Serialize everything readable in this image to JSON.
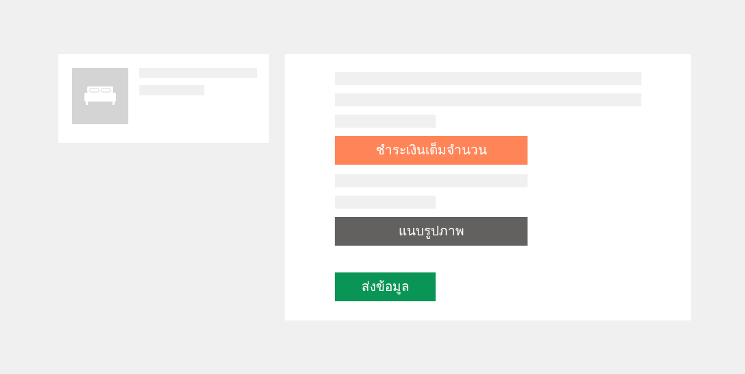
{
  "buttons": [
    {
      "label": "ชำระเงินเต็มจำนวน",
      "kind": "pay"
    },
    {
      "label": "แนบรูปภาพ",
      "kind": "attach"
    },
    {
      "label": "ส่งข้อมูล",
      "kind": "submit"
    }
  ]
}
